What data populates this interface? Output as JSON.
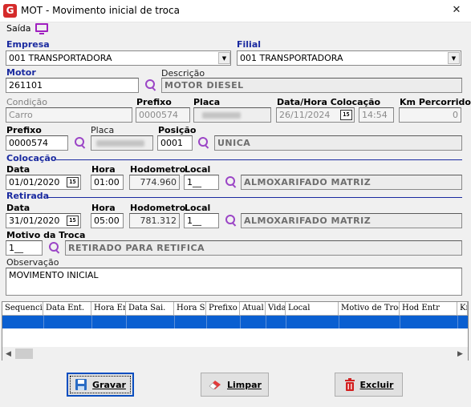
{
  "window": {
    "title": "MOT - Movimento inicial de troca",
    "close_glyph": "✕",
    "logo_glyph": "G"
  },
  "menu": {
    "saida": "Saída"
  },
  "empresa": {
    "label": "Empresa",
    "value": "001 TRANSPORTADORA"
  },
  "filial": {
    "label": "Filial",
    "value": "001 TRANSPORTADORA"
  },
  "motor": {
    "label": "Motor",
    "value": "261101",
    "descricao_label": "Descrição",
    "descricao": "MOTOR DIESEL"
  },
  "row3": {
    "condicao_label": "Condição",
    "condicao": "Carro",
    "prefixo_label": "Prefixo",
    "prefixo": "0000574",
    "placa_label": "Placa",
    "data_hora_label": "Data/Hora Colocação",
    "data": "26/11/2024",
    "hora": "14:54",
    "km_label": "Km Percorrido",
    "km": "0"
  },
  "row4": {
    "prefixo_label": "Prefixo",
    "prefixo": "0000574",
    "placa_label": "Placa",
    "posicao_label": "Posição",
    "posicao": "0001",
    "posicao_desc": "UNICA"
  },
  "colocacao": {
    "section": "Colocação",
    "data_label": "Data",
    "data": "01/01/2020",
    "hora_label": "Hora",
    "hora": "01:00",
    "hodometro_label": "Hodometro",
    "hodometro": "774.960",
    "local_label": "Local",
    "local": "1__",
    "local_desc": "ALMOXARIFADO MATRIZ"
  },
  "retirada": {
    "section": "Retirada",
    "data_label": "Data",
    "data": "31/01/2020",
    "hora_label": "Hora",
    "hora": "05:00",
    "hodometro_label": "Hodometro",
    "hodometro": "781.312",
    "local_label": "Local",
    "local": "1__",
    "local_desc": "ALMOXARIFADO MATRIZ"
  },
  "motivo": {
    "label": "Motivo da Troca",
    "value": "1__",
    "desc": "RETIRADO PARA RETIFICA"
  },
  "observacao": {
    "label": "Observação",
    "value": "MOVIMENTO INICIAL"
  },
  "grid": {
    "columns": [
      "Sequencia",
      "Data Ent.",
      "Hora Entr",
      "Data Sai.",
      "Hora Sai.",
      "Prefixo",
      "Atual",
      "Vida",
      "Local",
      "Motivo de Troca",
      "Hod Entr",
      "Kn"
    ]
  },
  "calendar_glyph": "15",
  "buttons": {
    "gravar": "Gravar",
    "limpar": "Limpar",
    "excluir": "Excluir"
  },
  "colors": {
    "section_blue": "#1a2aa0",
    "selection": "#0a5fd1",
    "search_purple": "#9b45c6"
  }
}
